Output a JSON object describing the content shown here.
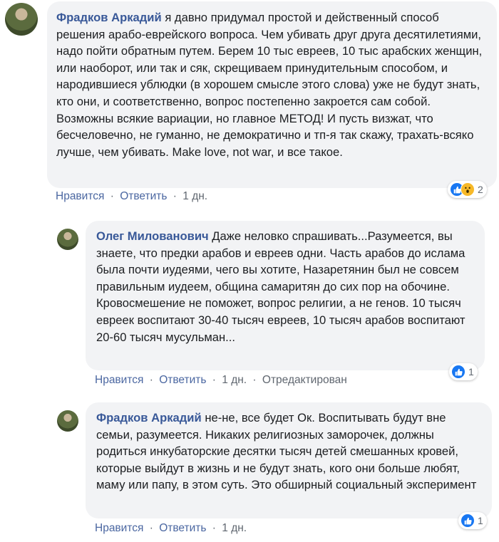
{
  "comments": [
    {
      "author": "Фрадков Аркадий",
      "text": "я давно придумал простой и действенный способ решения арабо-еврейского вопроса. Чем убивать друг друга десятилетиями, надо пойти обратным путем. Берем 10 тыс евреев, 10 тыс арабских женщин, или наоборот, или так и сяк, скрещиваем принудительным способом, и народившиеся ублюдки (в хорошем смысле этого слова) уже не будут знать, кто они, и соответственно, вопрос постепенно закроется сам собой. Возможны всякие вариации, но главное МЕТОД! И пусть визжат, что бесчеловечно, не гуманно, не демократично и тп-я так скажу, трахать-всяко лучше, чем убивать. Make love, not war, и все такое.",
      "like_label": "Нравится",
      "reply_label": "Ответить",
      "time": "1 дн.",
      "reactions": [
        "like-icon",
        "wow-icon"
      ],
      "reaction_count": "2"
    },
    {
      "author": "Олег Милованович",
      "text": "Даже неловко спрашивать...Разумеется, вы знаете, что предки арабов и евреев одни. Часть арабов до ислама была почти иудеями, чего вы хотите, Назаретянин был не совсем правильным иудеем, община самаритян до сих пор на обочине. Кровосмешение не поможет, вопрос религии, а не генов. 10 тысяч евреек воспитают 30-40 тысяч евреев, 10 тысяч арабов воспитают 20-60 тысяч мусульман...",
      "like_label": "Нравится",
      "reply_label": "Ответить",
      "time": "1 дн.",
      "edited": "Отредактирован",
      "reactions": [
        "like-icon"
      ],
      "reaction_count": "1"
    },
    {
      "author": "Фрадков Аркадий",
      "text": "не-не, все будет Ок. Воспитывать будут вне семьи, разумеется. Никаких религиозных заморочек, должны родиться инкубаторские десятки тысяч детей смешанных кровей, которые выйдут в жизнь и не будут знать, кого они больше любят, маму или папу, в этом суть. Это обширный социальный эксперимент",
      "like_label": "Нравится",
      "reply_label": "Ответить",
      "time": "1 дн.",
      "reactions": [
        "like-icon"
      ],
      "reaction_count": "1"
    }
  ],
  "separator": "·",
  "colors": {
    "author": "#385898",
    "action_link": "#4b67a1",
    "muted": "#606770",
    "bubble": "#f2f3f5",
    "like": "#1877f2",
    "wow": "#f7b928"
  }
}
